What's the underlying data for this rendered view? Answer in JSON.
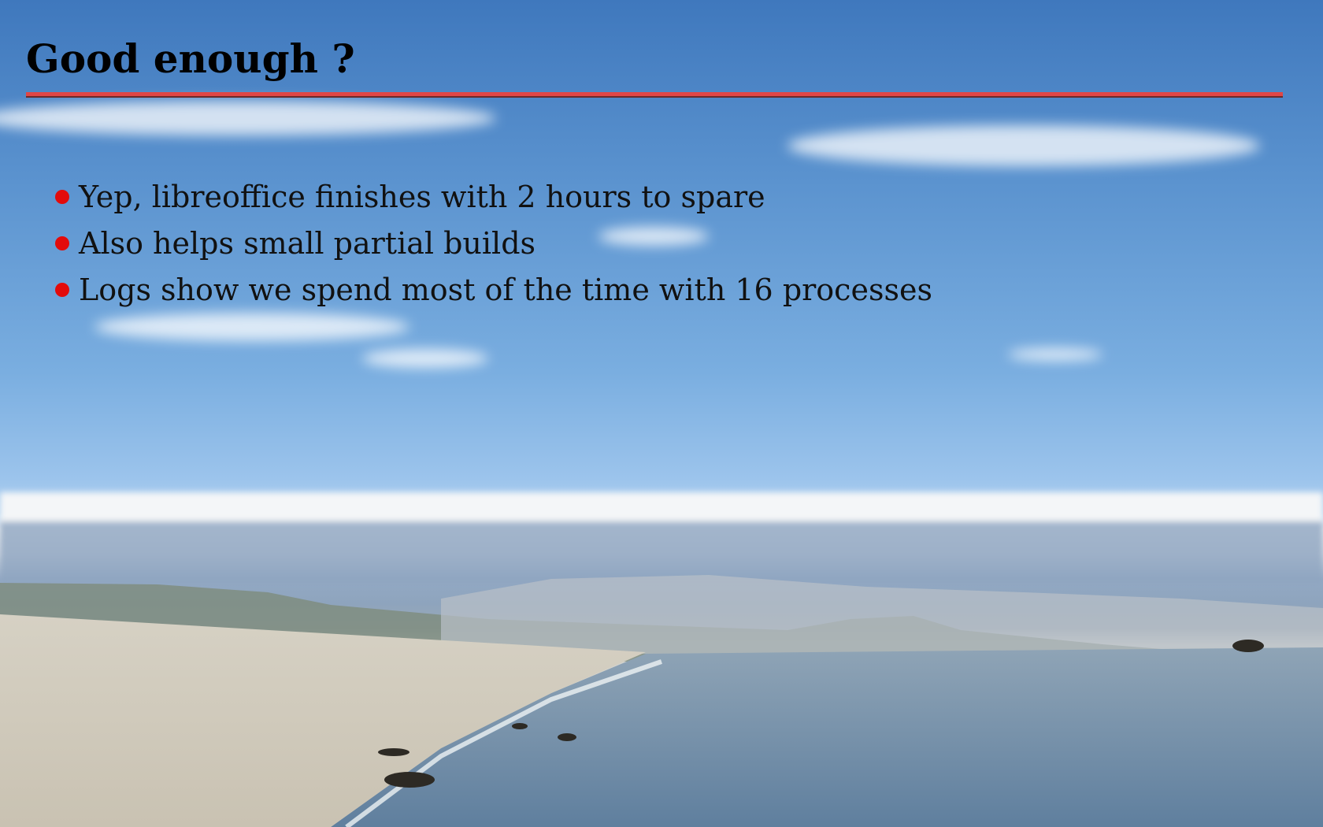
{
  "slide": {
    "title": "Good enough ?",
    "accent_color": "#e04646",
    "bullet_color": "#e30b0b",
    "bullets": [
      "Yep, libreoffice finishes with 2 hours to spare",
      "Also helps small partial builds",
      "Logs show we spend most of the time with 16 processes"
    ],
    "background": "beach-sky-photo"
  }
}
